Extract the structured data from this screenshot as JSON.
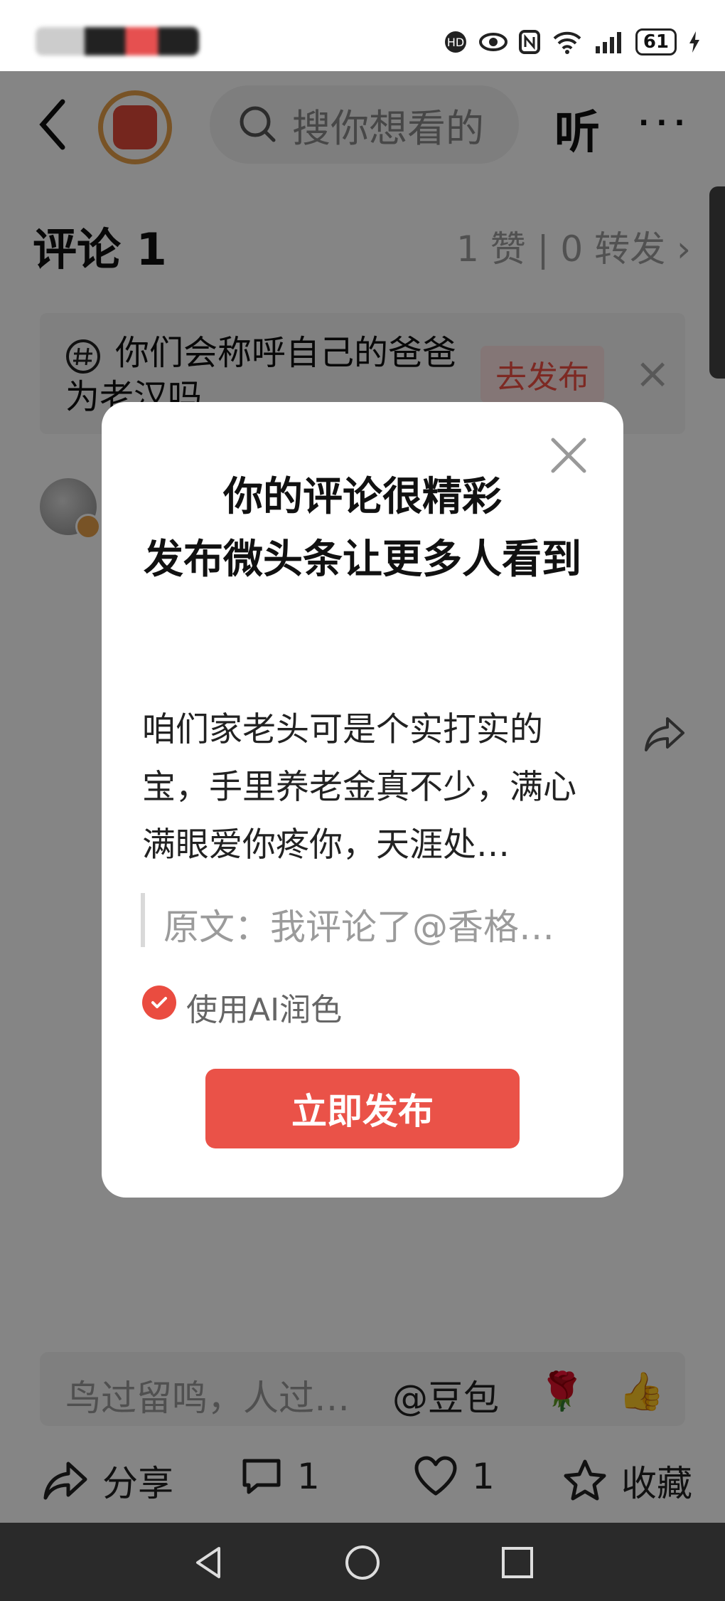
{
  "status_bar": {
    "battery": "61"
  },
  "header": {
    "search_placeholder": "搜你想看的",
    "listen_label": "听",
    "more_label": "···"
  },
  "comments": {
    "title": "评论 1",
    "stats": "1 赞 | 0 转发 ›"
  },
  "topic": {
    "text": "你们会称呼自己的爸爸为老汉吗",
    "publish_button": "去发布",
    "close": "×"
  },
  "modal": {
    "title_line1": "你的评论很精彩",
    "title_line2": "发布微头条让更多人看到",
    "body": "咱们家老头可是个实打实的宝，手里养老金真不少，满心满眼爱你疼你，天涯处…",
    "quote": "原文：我评论了@香格…",
    "ai_polish_label": "使用AI润色",
    "ai_polish_checked": true,
    "publish_button": "立即发布",
    "close_icon": "close-icon"
  },
  "input_bar": {
    "placeholder": "鸟过留鸣，人过…",
    "doubao": "@豆包",
    "rose": "🌹",
    "thumb": "👍"
  },
  "actions": {
    "share": "分享",
    "comment_count": "1",
    "like_count": "1",
    "favorite": "收藏"
  },
  "colors": {
    "accent": "#ea5248",
    "overlay": "rgba(0,0,0,0.48)"
  }
}
